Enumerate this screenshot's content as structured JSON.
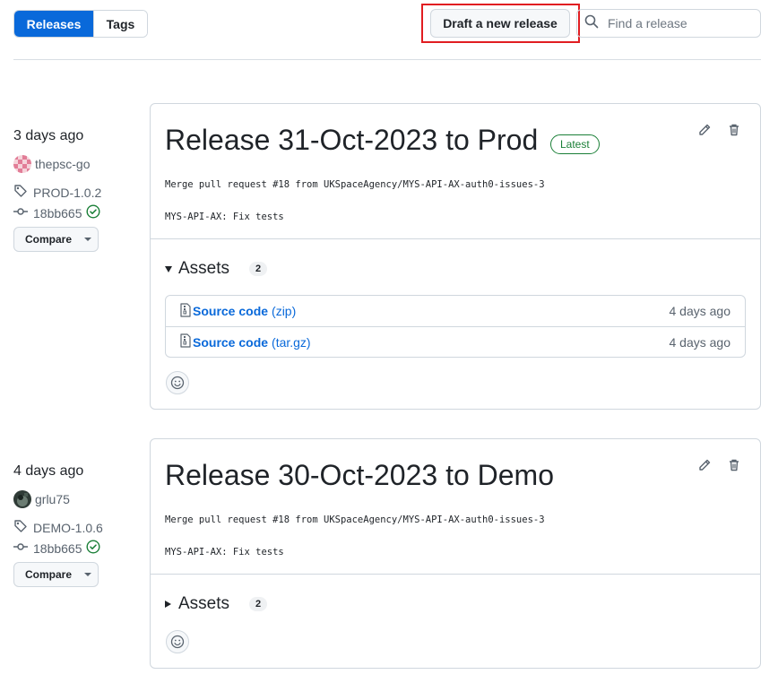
{
  "tabs": {
    "releases": "Releases",
    "tags": "Tags"
  },
  "actions": {
    "draft_label": "Draft a new release"
  },
  "search": {
    "placeholder": "Find a release"
  },
  "releases": [
    {
      "when": "3 days ago",
      "author": "thepsc-go",
      "tag": "PROD-1.0.2",
      "commit": "18bb665",
      "compare_label": "Compare",
      "title": "Release 31-Oct-2023 to Prod",
      "latest_badge": "Latest",
      "body_line1": "Merge pull request #18 from UKSpaceAgency/MYS-API-AX-auth0-issues-3",
      "body_line2": "MYS-API-AX: Fix tests",
      "assets_label": "Assets",
      "assets_count": "2",
      "assets_expanded": true,
      "assets": [
        {
          "name": "Source code",
          "format": "(zip)",
          "date": "4 days ago"
        },
        {
          "name": "Source code",
          "format": "(tar.gz)",
          "date": "4 days ago"
        }
      ]
    },
    {
      "when": "4 days ago",
      "author": "grlu75",
      "tag": "DEMO-1.0.6",
      "commit": "18bb665",
      "compare_label": "Compare",
      "title": "Release 30-Oct-2023 to Demo",
      "body_line1": "Merge pull request #18 from UKSpaceAgency/MYS-API-AX-auth0-issues-3",
      "body_line2": "MYS-API-AX: Fix tests",
      "assets_label": "Assets",
      "assets_count": "2",
      "assets_expanded": false
    }
  ],
  "colors": {
    "accent": "#0969da",
    "latest": "#1a7f37",
    "highlight": "#e11d21"
  }
}
